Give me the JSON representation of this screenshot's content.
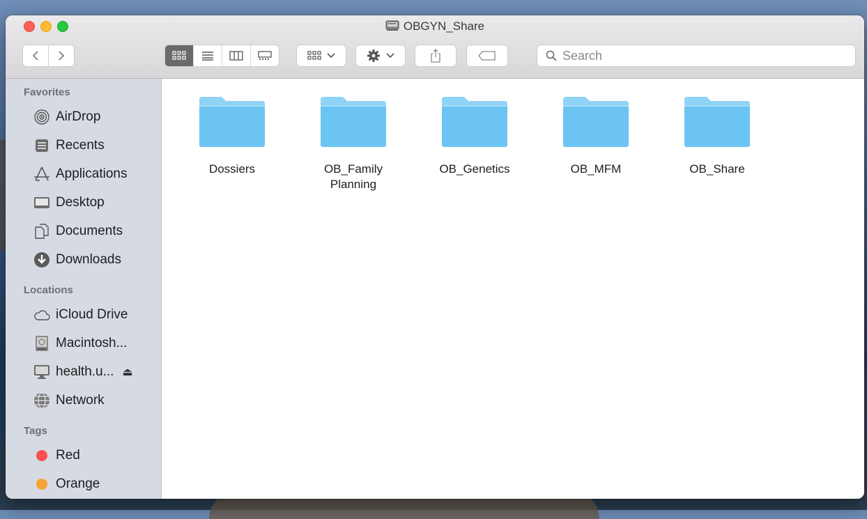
{
  "window": {
    "title": "OBGYN_Share"
  },
  "toolbar": {
    "view_modes": [
      "icon",
      "list",
      "column",
      "gallery"
    ],
    "active_view": "icon",
    "search_placeholder": "Search"
  },
  "sidebar": {
    "sections": [
      {
        "heading": "Favorites",
        "items": [
          {
            "label": "AirDrop",
            "icon": "airdrop-icon"
          },
          {
            "label": "Recents",
            "icon": "recents-icon"
          },
          {
            "label": "Applications",
            "icon": "applications-icon"
          },
          {
            "label": "Desktop",
            "icon": "desktop-icon"
          },
          {
            "label": "Documents",
            "icon": "documents-icon"
          },
          {
            "label": "Downloads",
            "icon": "downloads-icon"
          }
        ]
      },
      {
        "heading": "Locations",
        "items": [
          {
            "label": "iCloud Drive",
            "icon": "icloud-icon"
          },
          {
            "label": "Macintosh...",
            "icon": "harddrive-icon"
          },
          {
            "label": "health.u...",
            "icon": "server-icon",
            "eject": "⏏"
          },
          {
            "label": "Network",
            "icon": "network-icon"
          }
        ]
      },
      {
        "heading": "Tags",
        "items": [
          {
            "label": "Red",
            "icon": "tag-dot-icon",
            "color": "#fd4f4f"
          },
          {
            "label": "Orange",
            "icon": "tag-dot-icon",
            "color": "#f9a232"
          }
        ]
      }
    ]
  },
  "folders": [
    {
      "line1": "Dossiers",
      "line2": ""
    },
    {
      "line1": "OB_Family",
      "line2": "Planning"
    },
    {
      "line1": "OB_Genetics",
      "line2": ""
    },
    {
      "line1": "OB_MFM",
      "line2": ""
    },
    {
      "line1": "OB_Share",
      "line2": ""
    }
  ],
  "colors": {
    "folder": "#6cc4f3",
    "folder_tab": "#8fd3f7",
    "sidebar_bg": "#d6dbe3"
  }
}
